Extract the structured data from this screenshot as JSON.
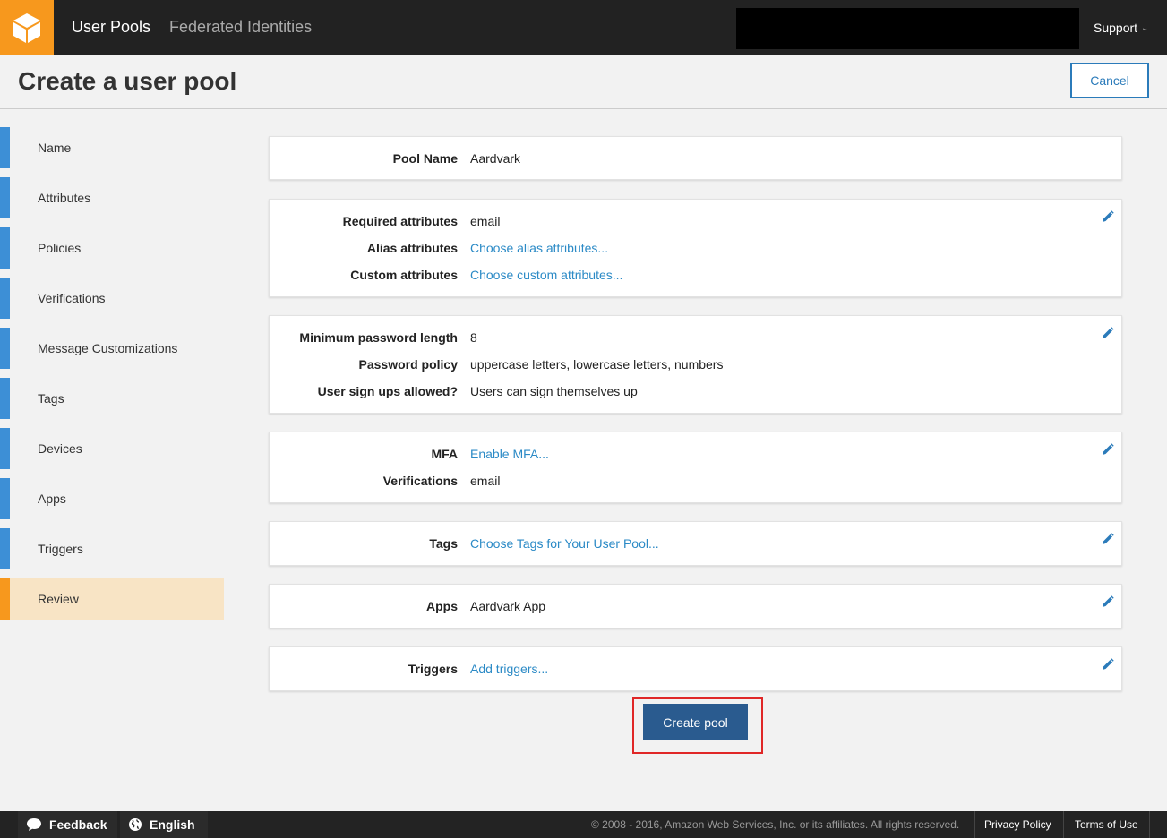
{
  "topbar": {
    "nav_main": "User Pools",
    "nav_second": "Federated Identities",
    "support": "Support"
  },
  "header": {
    "title": "Create a user pool",
    "cancel": "Cancel"
  },
  "sidebar": {
    "items": [
      {
        "label": "Name"
      },
      {
        "label": "Attributes"
      },
      {
        "label": "Policies"
      },
      {
        "label": "Verifications"
      },
      {
        "label": "Message Customizations"
      },
      {
        "label": "Tags"
      },
      {
        "label": "Devices"
      },
      {
        "label": "Apps"
      },
      {
        "label": "Triggers"
      },
      {
        "label": "Review"
      }
    ],
    "active": "Review"
  },
  "review": {
    "pool_name": {
      "label": "Pool Name",
      "value": "Aardvark"
    },
    "attributes": {
      "required": {
        "label": "Required attributes",
        "value": "email"
      },
      "alias": {
        "label": "Alias attributes",
        "value": "Choose alias attributes..."
      },
      "custom": {
        "label": "Custom attributes",
        "value": "Choose custom attributes..."
      }
    },
    "policies": {
      "min_length": {
        "label": "Minimum password length",
        "value": "8"
      },
      "policy": {
        "label": "Password policy",
        "value": "uppercase letters, lowercase letters, numbers"
      },
      "signups": {
        "label": "User sign ups allowed?",
        "value": "Users can sign themselves up"
      }
    },
    "verifications": {
      "mfa": {
        "label": "MFA",
        "value": "Enable MFA..."
      },
      "verif": {
        "label": "Verifications",
        "value": "email"
      }
    },
    "tags": {
      "label": "Tags",
      "value": "Choose Tags for Your User Pool..."
    },
    "apps": {
      "label": "Apps",
      "value": "Aardvark App"
    },
    "triggers": {
      "label": "Triggers",
      "value": "Add triggers..."
    }
  },
  "create_button": "Create pool",
  "footer": {
    "feedback": "Feedback",
    "language": "English",
    "copyright": "© 2008 - 2016, Amazon Web Services, Inc. or its affiliates. All rights reserved.",
    "privacy": "Privacy Policy",
    "terms": "Terms of Use"
  },
  "colors": {
    "brand_orange": "#f7981d",
    "link_blue": "#2b8ac6",
    "primary_button": "#2a5b8f",
    "highlight_red": "#e02727"
  }
}
